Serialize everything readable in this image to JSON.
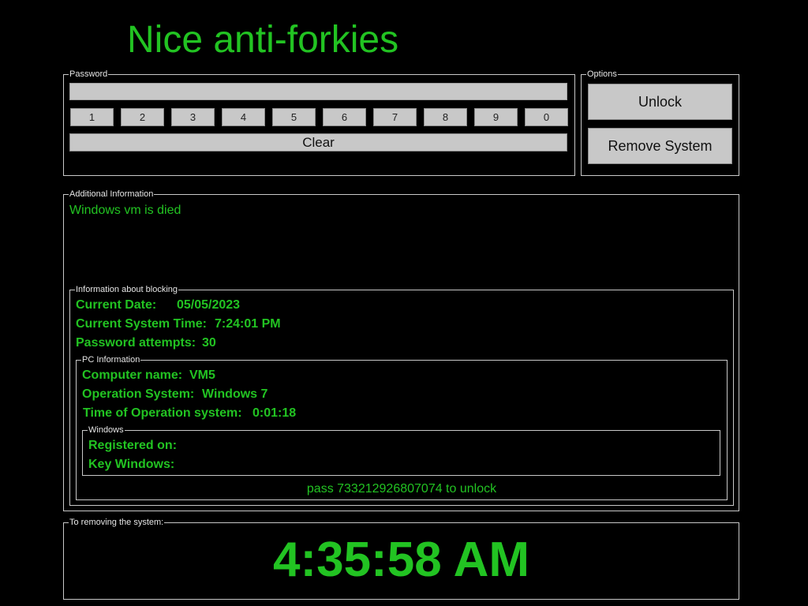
{
  "window": {
    "title": "Nice anti-forkies"
  },
  "password_group": {
    "legend": "Password",
    "input_value": "",
    "input_placeholder": "",
    "digits": [
      "1",
      "2",
      "3",
      "4",
      "5",
      "6",
      "7",
      "8",
      "9",
      "0"
    ],
    "clear_label": "Clear"
  },
  "options_group": {
    "legend": "Options",
    "unlock_label": "Unlock",
    "remove_label": "Remove System"
  },
  "additional_info": {
    "legend": "Additional Information",
    "message": "Windows vm is died"
  },
  "blocking_info": {
    "legend": "Information about blocking",
    "current_date_label": "Current Date:",
    "current_date_value": "05/05/2023",
    "system_time_label": "Current System Time:",
    "system_time_value": "7:24:01 PM",
    "attempts_label": "Password attempts:",
    "attempts_value": "30"
  },
  "pc_info": {
    "legend": "PC Information",
    "computer_name_label": "Computer name:",
    "computer_name_value": "VM5",
    "os_label": "Operation System:",
    "os_value": "Windows 7",
    "os_time_label": "Time of Operation system:",
    "os_time_value": "0:01:18"
  },
  "windows_info": {
    "legend": "Windows",
    "registered_label": "Registered on:",
    "registered_value": "",
    "key_label": "Key Windows:",
    "key_value": ""
  },
  "hint": {
    "text": "pass 733212926807074 to unlock"
  },
  "removal": {
    "legend": "To removing the system:",
    "countdown": "4:35:58 AM"
  },
  "colors": {
    "background": "#000000",
    "accent_green": "#22c322",
    "button_gray": "#c8c8c8",
    "border_gray": "#c8c8c8"
  }
}
